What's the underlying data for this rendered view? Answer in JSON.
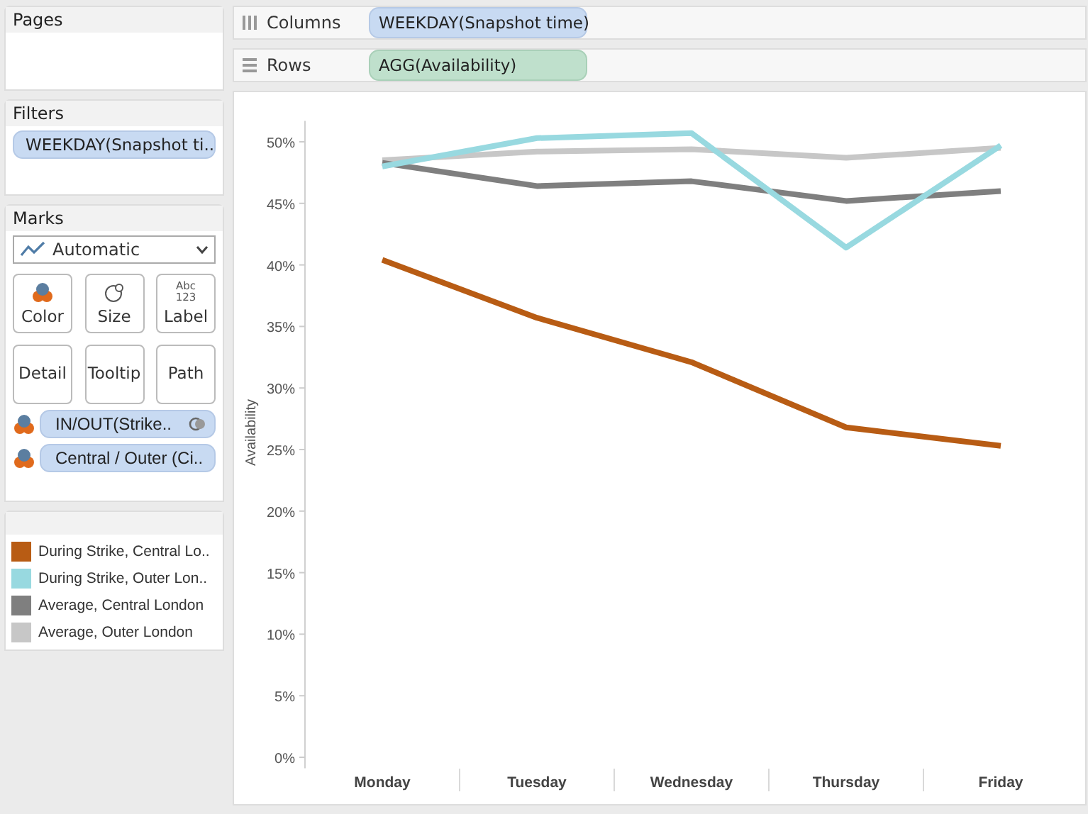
{
  "pages": {
    "title": "Pages"
  },
  "columns_shelf": {
    "label": "Columns",
    "pill": "WEEKDAY(Snapshot time)"
  },
  "rows_shelf": {
    "label": "Rows",
    "pill": "AGG(Availability)"
  },
  "filters": {
    "title": "Filters",
    "pills": [
      "WEEKDAY(Snapshot ti.."
    ]
  },
  "marks": {
    "title": "Marks",
    "mark_type": "Automatic",
    "cards": [
      {
        "label": "Color",
        "kind": "color"
      },
      {
        "label": "Size",
        "kind": "size"
      },
      {
        "label": "Label",
        "kind": "label",
        "icon_text": [
          "Abc",
          "123"
        ]
      },
      {
        "label": "Detail",
        "kind": "none"
      },
      {
        "label": "Tooltip",
        "kind": "none"
      },
      {
        "label": "Path",
        "kind": "none"
      }
    ],
    "fields": [
      {
        "label": "IN/OUT(Strike..",
        "linked": true
      },
      {
        "label": "Central / Outer (Ci..",
        "linked": false
      }
    ]
  },
  "chart": {
    "chart_data": {
      "type": "line",
      "ylabel": "Availability",
      "categories": [
        "Monday",
        "Tuesday",
        "Wednesday",
        "Thursday",
        "Friday"
      ],
      "ylim": [
        -0.9,
        51.7
      ],
      "yticks": [
        {
          "value": 0,
          "label": "0%"
        },
        {
          "value": 5,
          "label": "5%"
        },
        {
          "value": 10,
          "label": "10%"
        },
        {
          "value": 15,
          "label": "15%"
        },
        {
          "value": 20,
          "label": "20%"
        },
        {
          "value": 25,
          "label": "25%"
        },
        {
          "value": 30,
          "label": "30%"
        },
        {
          "value": 35,
          "label": "35%"
        },
        {
          "value": 40,
          "label": "40%"
        },
        {
          "value": 45,
          "label": "45%"
        },
        {
          "value": 50,
          "label": "50%"
        }
      ],
      "series": [
        {
          "name": "During Strike, Central Lo..",
          "color": "#b85c14",
          "values": [
            40.4,
            35.7,
            32.1,
            26.8,
            25.3
          ]
        },
        {
          "name": "During Strike, Outer Lon..",
          "color": "#98d9e0",
          "values": [
            48.0,
            50.3,
            50.7,
            41.4,
            49.7
          ]
        },
        {
          "name": "Average, Central London",
          "color": "#7f7f7f",
          "values": [
            48.3,
            46.4,
            46.8,
            45.2,
            46.0
          ]
        },
        {
          "name": "Average, Outer London",
          "color": "#c7c7c7",
          "values": [
            48.5,
            49.2,
            49.4,
            48.7,
            49.5
          ]
        }
      ]
    }
  }
}
